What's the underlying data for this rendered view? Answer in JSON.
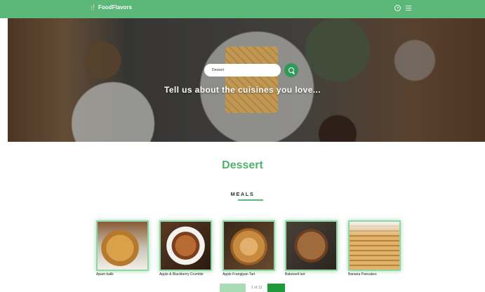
{
  "navbar": {
    "brand_icon": "utensils-icon",
    "brand": "FoodFlavors",
    "icons": [
      "user-icon",
      "menu-icon"
    ]
  },
  "hero": {
    "search": {
      "value": "Dessert",
      "placeholder": "Dessert",
      "button_icon": "search-icon"
    },
    "tagline": "Tell us about the cuisines you love..."
  },
  "category": {
    "title": "Dessert"
  },
  "meals_section": {
    "label": "MEALS",
    "items": [
      {
        "name": "Apam balik"
      },
      {
        "name": "Apple & Blackberry Crumble"
      },
      {
        "name": "Apple Frangipan Tart"
      },
      {
        "name": "Bakewell tart"
      },
      {
        "name": "Banana Pancakes"
      }
    ]
  },
  "pagination": {
    "prev_label": "",
    "info": "1 of 13",
    "next_label": ""
  },
  "colors": {
    "brand_green": "#5cb878",
    "title_green": "#52b06f",
    "button_green": "#2e9a5a",
    "next_green": "#1f9a3b"
  }
}
